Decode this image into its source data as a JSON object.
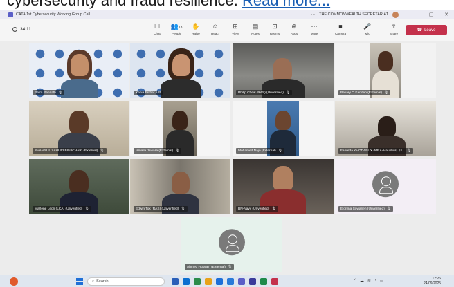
{
  "headline": {
    "text": "cybersecurity and fraud resilience.",
    "link": "Read more..."
  },
  "window": {
    "title": "CATA 1st Cybersecurity Working Group Call",
    "more": "···",
    "org": "THE COMMONWEALTH SECRETARIAT",
    "minimize": "–",
    "restore": "▢",
    "close": "✕"
  },
  "toolbar": {
    "timer": "34:11",
    "tools": [
      {
        "label": "Chat",
        "icon": "☐"
      },
      {
        "label": "People",
        "icon": "👥",
        "count": "13"
      },
      {
        "label": "Raise",
        "icon": "✋"
      },
      {
        "label": "React",
        "icon": "☺"
      },
      {
        "label": "View",
        "icon": "⊞"
      },
      {
        "label": "Notes",
        "icon": "▤"
      },
      {
        "label": "Rooms",
        "icon": "⊡"
      },
      {
        "label": "Apps",
        "icon": "⊕"
      },
      {
        "label": "More",
        "icon": "···"
      },
      {
        "label": "Camera",
        "icon": "■"
      },
      {
        "label": "Mic",
        "icon": "🎤"
      },
      {
        "label": "Share",
        "icon": "⇧"
      }
    ],
    "leave": "Leave"
  },
  "participants": [
    {
      "name": "Petra Rannath",
      "muted": true
    },
    {
      "name": "Xenia Esther A/P",
      "muted": false
    },
    {
      "name": "Philip Chew (RAS) (Unverified)",
      "muted": true
    },
    {
      "name": "Bakary O Kandeh (External)",
      "muted": true
    },
    {
      "name": "SHAMSUL ZAHURI BIN ICHARI (External)",
      "muted": true
    },
    {
      "name": "Ismaila Jawara (External)",
      "muted": true
    },
    {
      "name": "Mohamed Najo (External)",
      "muted": true
    },
    {
      "name": "Fahreda KHODABUX (MRA-Mauritius) (U...",
      "muted": true
    },
    {
      "name": "Marlene Leon (LCA) (Unverified)",
      "muted": true
    },
    {
      "name": "Edwin Tok (RAS) (Unverified)",
      "muted": true
    },
    {
      "name": "BN-Navy (Unverified)",
      "muted": true
    },
    {
      "name": "Elorima Sowaneh (Unverified)",
      "muted": true
    },
    {
      "name": "Ahmed Hussain (External)",
      "muted": true
    }
  ],
  "mic_glyph": "🎙",
  "taskbar": {
    "search": "Search",
    "time": "12:26",
    "date": "24/09/2025"
  },
  "colors": {
    "accent": "#5b5fc7",
    "leave": "#c4314b"
  }
}
